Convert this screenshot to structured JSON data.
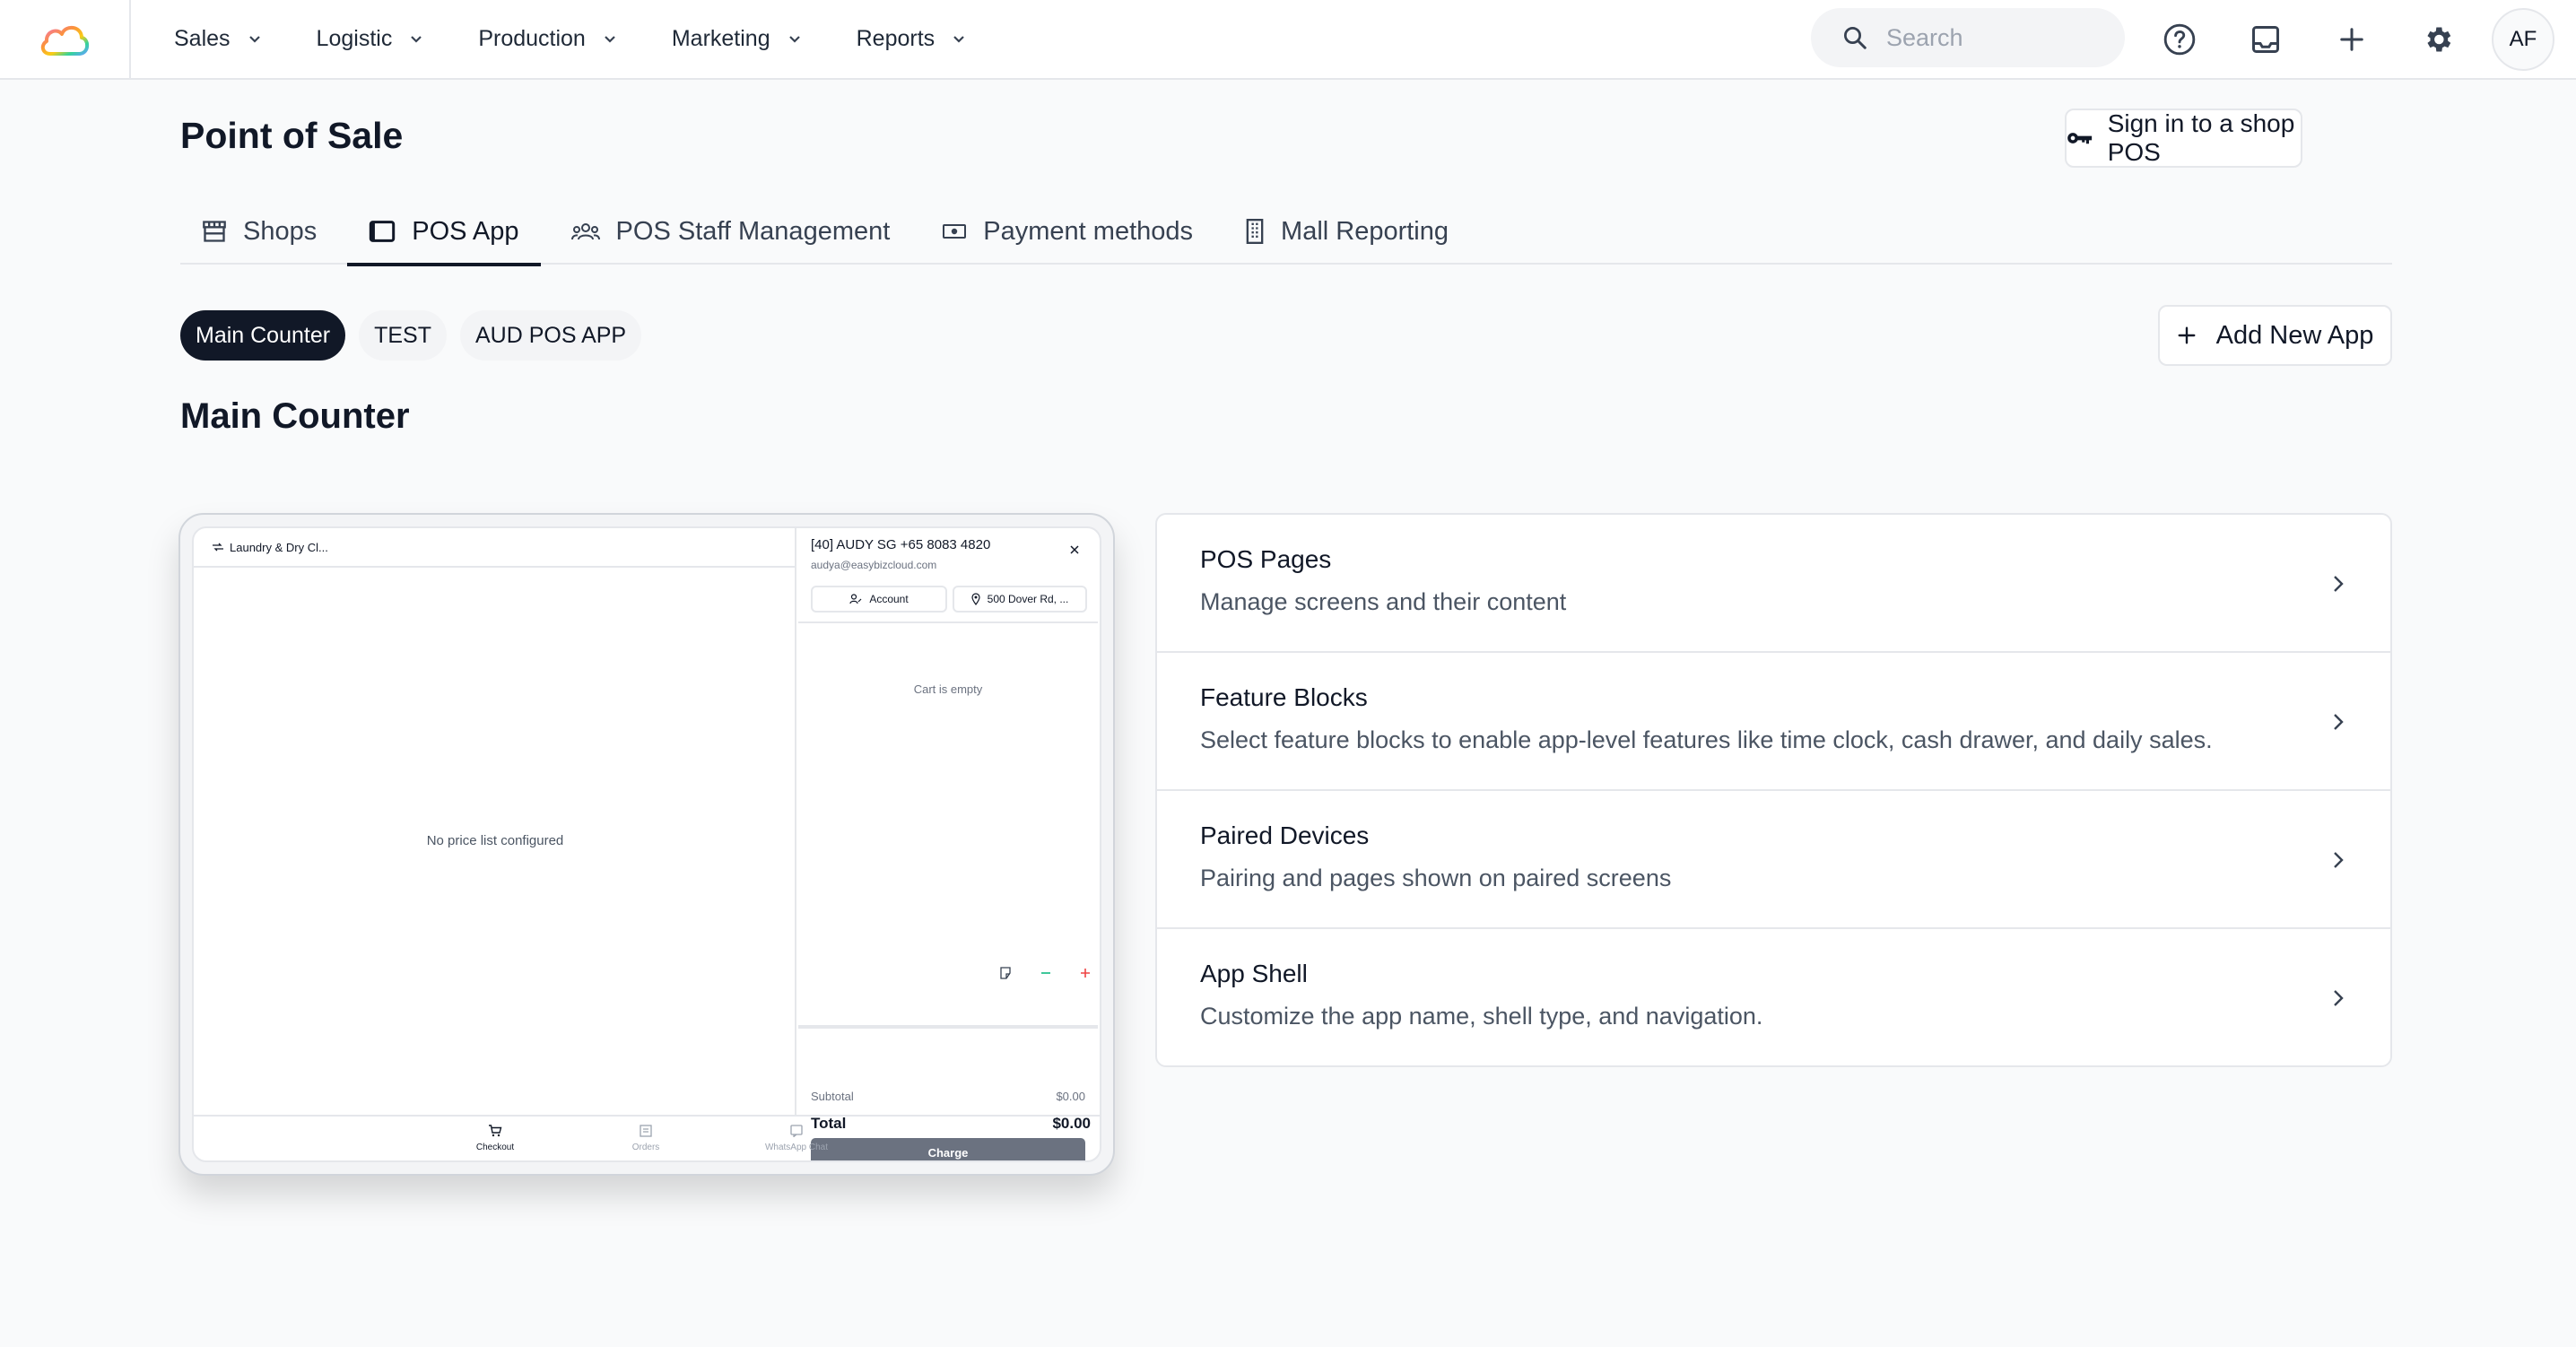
{
  "nav": {
    "items": [
      {
        "label": "Sales"
      },
      {
        "label": "Logistic"
      },
      {
        "label": "Production"
      },
      {
        "label": "Marketing"
      },
      {
        "label": "Reports"
      }
    ],
    "search_placeholder": "Search",
    "avatar_initials": "AF"
  },
  "header": {
    "title": "Point of Sale",
    "signin_label": "Sign in to a shop POS"
  },
  "tabs": [
    {
      "label": "Shops",
      "icon": "storefront-icon"
    },
    {
      "label": "POS App",
      "icon": "tablet-icon",
      "active": true
    },
    {
      "label": "POS Staff Management",
      "icon": "people-icon"
    },
    {
      "label": "Payment methods",
      "icon": "cash-icon"
    },
    {
      "label": "Mall Reporting",
      "icon": "building-icon"
    }
  ],
  "apps": {
    "pills": [
      {
        "label": "Main Counter",
        "active": true
      },
      {
        "label": "TEST"
      },
      {
        "label": "AUD POS APP"
      }
    ],
    "add_label": "Add New App"
  },
  "section_title": "Main Counter",
  "preview": {
    "shop_selector": "Laundry & Dry Cl...",
    "no_price_list": "No price list configured",
    "customer_name": "[40] AUDY SG +65 8083 4820",
    "customer_email": "audya@easybizcloud.com",
    "account_label": "Account",
    "address_label": "500 Dover Rd, ...",
    "cart_empty": "Cart is empty",
    "subtotal_label": "Subtotal",
    "subtotal_value": "$0.00",
    "total_label": "Total",
    "total_value": "$0.00",
    "charge_label": "Charge",
    "bottom_nav": [
      {
        "label": "Checkout",
        "active": true
      },
      {
        "label": "Orders"
      },
      {
        "label": "WhatsApp Chat"
      }
    ]
  },
  "settings": [
    {
      "title": "POS Pages",
      "desc": "Manage screens and their content"
    },
    {
      "title": "Feature Blocks",
      "desc": "Select feature blocks to enable app-level features like time clock, cash drawer, and daily sales."
    },
    {
      "title": "Paired Devices",
      "desc": "Pairing and pages shown on paired screens"
    },
    {
      "title": "App Shell",
      "desc": "Customize the app name, shell type, and navigation."
    }
  ],
  "colors": {
    "accent": "#111827",
    "muted": "#6b7280",
    "border": "#e5e7eb",
    "danger": "#ef4444",
    "success": "#10b981"
  }
}
